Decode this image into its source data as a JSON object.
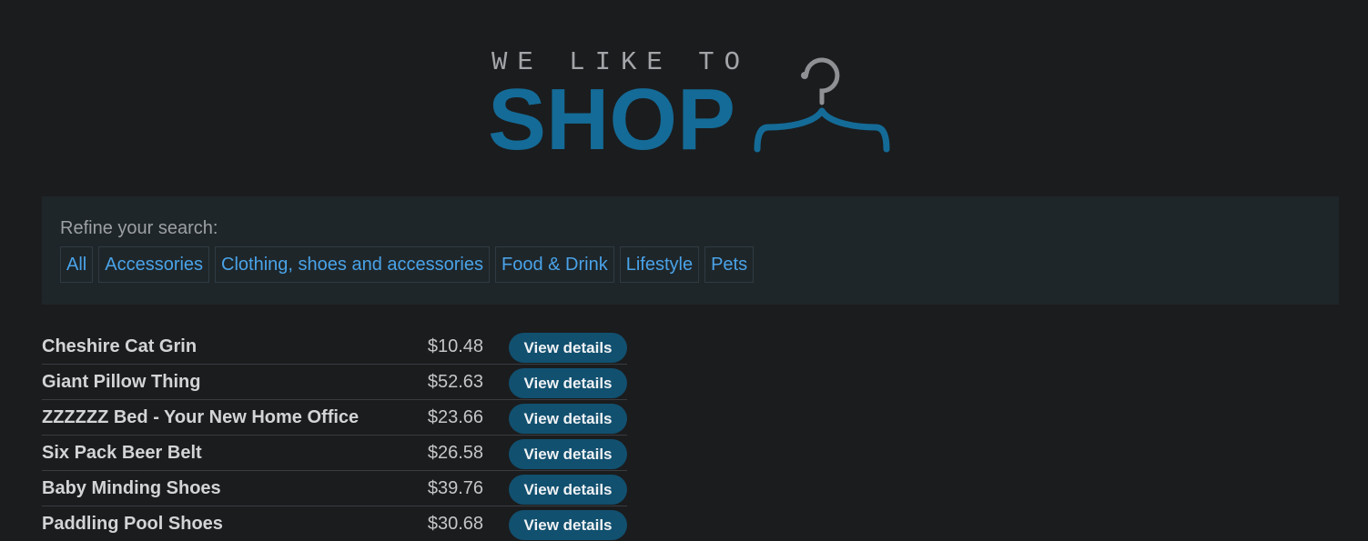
{
  "logo": {
    "tagline": "WE LIKE TO",
    "brand": "SHOP",
    "icon": "hanger-icon"
  },
  "filters": {
    "title": "Refine your search:",
    "categories": [
      "All",
      "Accessories",
      "Clothing, shoes and accessories",
      "Food & Drink",
      "Lifestyle",
      "Pets"
    ]
  },
  "products": [
    {
      "name": "Cheshire Cat Grin",
      "price": "$10.48",
      "action": "View details"
    },
    {
      "name": "Giant Pillow Thing",
      "price": "$52.63",
      "action": "View details"
    },
    {
      "name": "ZZZZZZ Bed - Your New Home Office",
      "price": "$23.66",
      "action": "View details"
    },
    {
      "name": "Six Pack Beer Belt",
      "price": "$26.58",
      "action": "View details"
    },
    {
      "name": "Baby Minding Shoes",
      "price": "$39.76",
      "action": "View details"
    },
    {
      "name": "Paddling Pool Shoes",
      "price": "$30.68",
      "action": "View details"
    }
  ],
  "colors": {
    "background": "#1b1c1e",
    "brand_blue": "#146b97",
    "link_blue": "#4aa3e8",
    "button_bg": "#11506f"
  }
}
